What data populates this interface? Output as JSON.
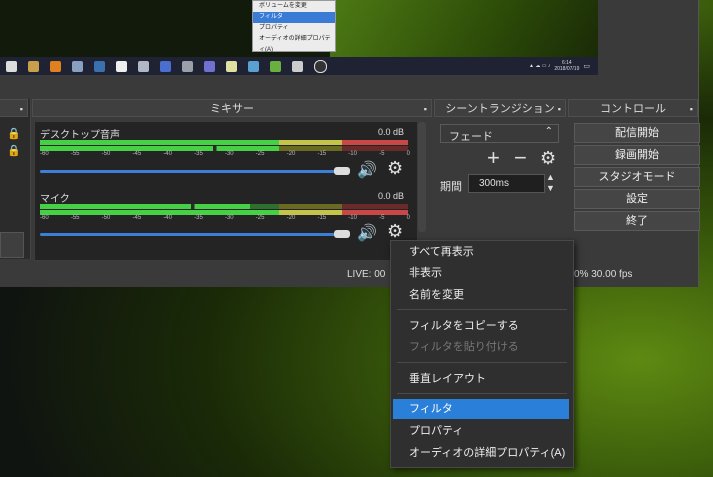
{
  "preview": {
    "menu_items": [
      "ボリュームを変更",
      "フィルタ",
      "プロパティ",
      "オーディオの詳細プロパティ(A)"
    ]
  },
  "taskbar": {
    "time": "6:14",
    "date": "2018/07/19"
  },
  "mixer": {
    "title": "ミキサー",
    "channels": [
      {
        "name": "デスクトップ音声",
        "db": "0.0 dB"
      },
      {
        "name": "マイク",
        "db": "0.0 dB"
      }
    ],
    "scale": [
      "-60",
      "-55",
      "-50",
      "-45",
      "-40",
      "-35",
      "-30",
      "-25",
      "-20",
      "-15",
      "-10",
      "-5",
      "0"
    ]
  },
  "transitions": {
    "title": "シーントランジション",
    "selected": "フェード",
    "duration_label": "期間",
    "duration_value": "300ms"
  },
  "controls": {
    "title": "コントロール",
    "buttons": [
      "配信開始",
      "録画開始",
      "スタジオモード",
      "設定",
      "終了"
    ]
  },
  "status": {
    "live": "LIVE: 00",
    "fps": "0% 30.00 fps"
  },
  "context_menu": {
    "items": [
      "すべて再表示",
      "非表示",
      "名前を変更",
      "フィルタをコピーする",
      "フィルタを貼り付ける",
      "垂直レイアウト",
      "フィルタ",
      "プロパティ",
      "オーディオの詳細プロパティ(A)"
    ]
  },
  "colors": {
    "accent": "#2a7fd8",
    "panel": "#2b2b2b",
    "meter_green": "#49d849",
    "meter_yellow": "#d8d84a",
    "meter_red": "#d84a4a"
  }
}
